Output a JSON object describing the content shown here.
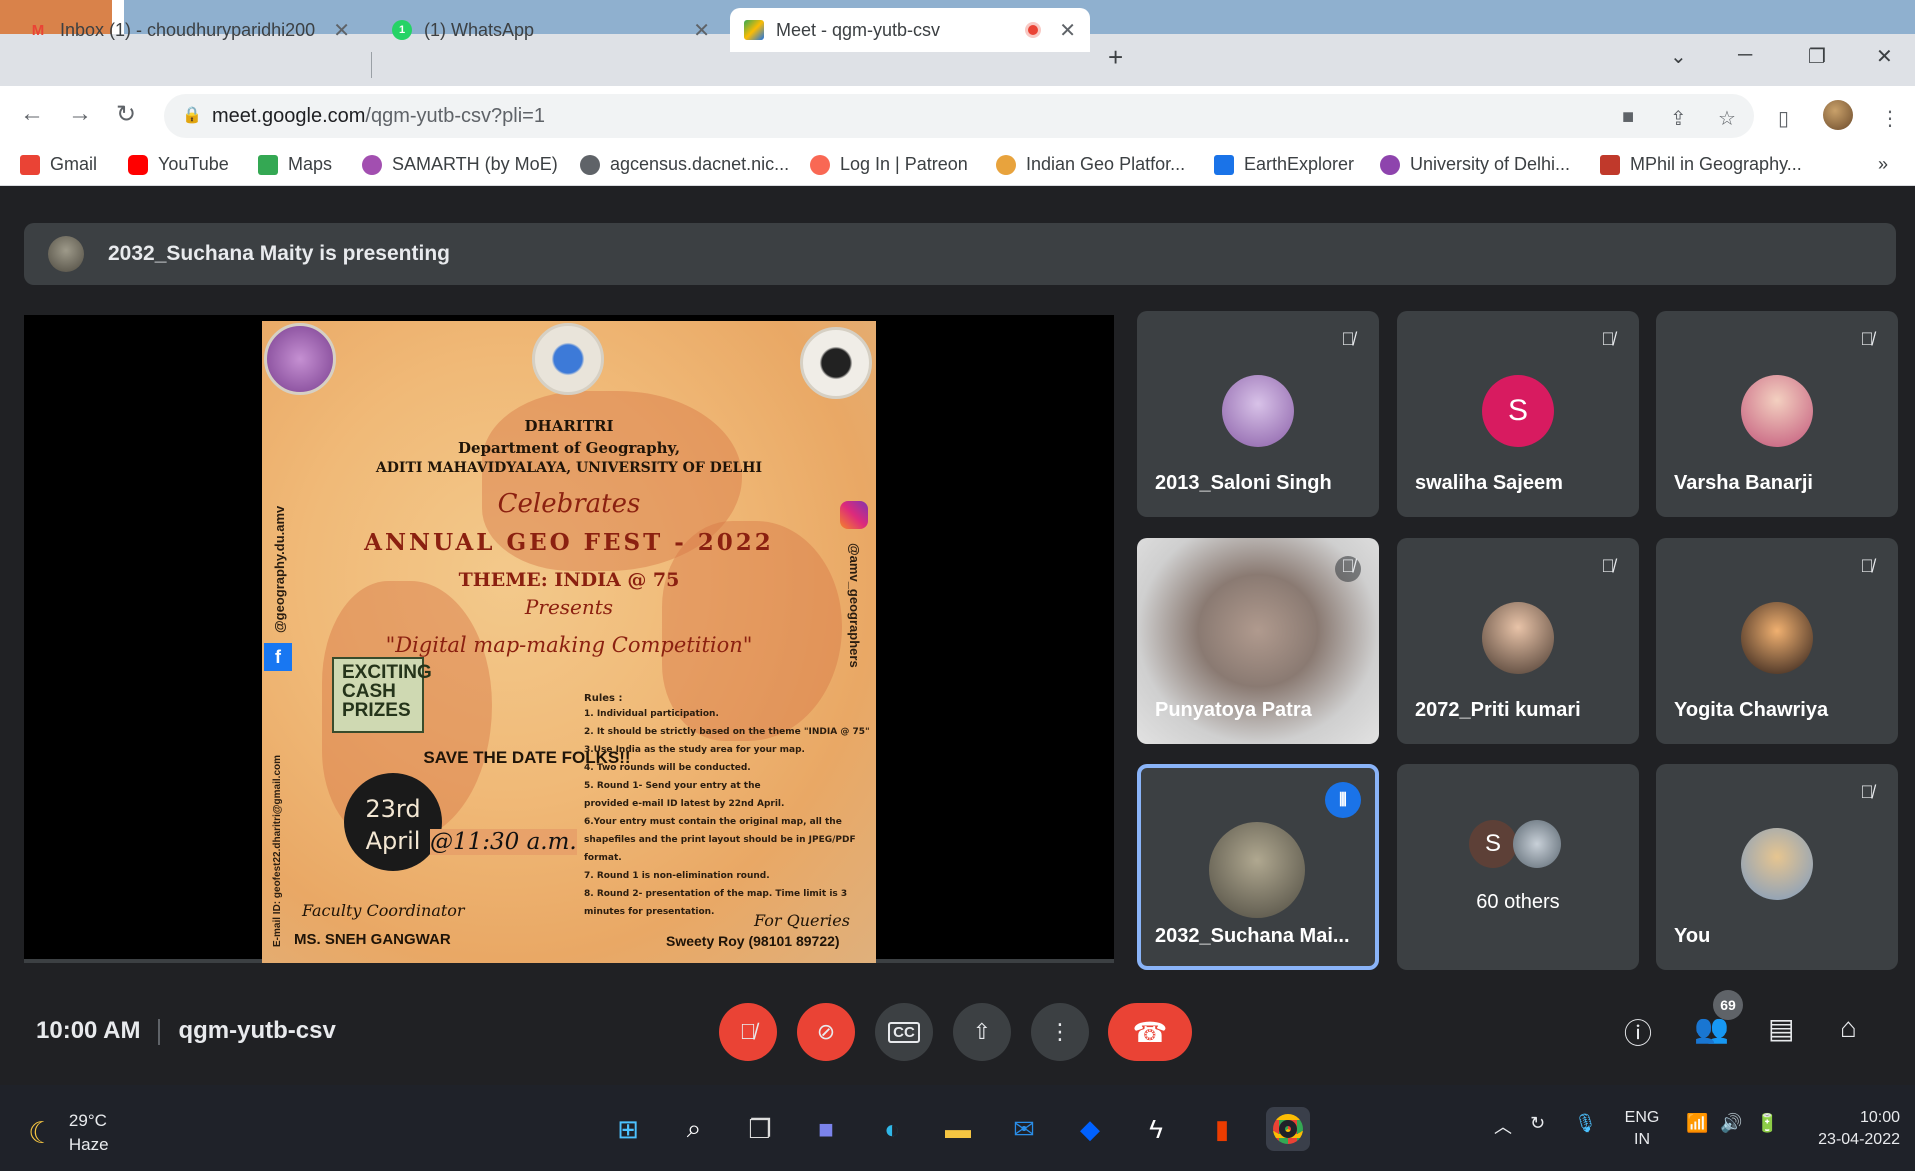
{
  "browser": {
    "tabs": [
      {
        "title": "Inbox (1) - choudhuryparidhi200",
        "icon": "gmail-icon"
      },
      {
        "title": "(1) WhatsApp",
        "icon": "whatsapp-icon"
      },
      {
        "title": "Meet - qgm-yutb-csv",
        "icon": "meet-icon",
        "active": true
      }
    ],
    "new_tab": "+",
    "url_host": "meet.google.com",
    "url_path": "/qgm-yutb-csv?pli=1",
    "bookmarks": [
      {
        "label": "Gmail",
        "color": "#ea4335"
      },
      {
        "label": "YouTube",
        "color": "#ff0000"
      },
      {
        "label": "Maps",
        "color": "#34a853"
      },
      {
        "label": "SAMARTH (by MoE)",
        "color": "#a24fb0"
      },
      {
        "label": "agcensus.dacnet.nic...",
        "color": "#5f6368"
      },
      {
        "label": "Log In | Patreon",
        "color": "#f96854"
      },
      {
        "label": "Indian Geo Platfor...",
        "color": "#e8a33d"
      },
      {
        "label": "EarthExplorer",
        "color": "#1a73e8"
      },
      {
        "label": "University of Delhi...",
        "color": "#8e44ad"
      },
      {
        "label": "MPhil in Geography...",
        "color": "#c0392b"
      }
    ],
    "more_bookmarks": "»"
  },
  "meet": {
    "presenting_banner": "2032_Suchana Maity is presenting",
    "poster": {
      "org": "DHARITRI",
      "dept": "Department of Geography,",
      "college": "ADITI MAHAVIDYALAYA, UNIVERSITY OF DELHI",
      "celebrates": "Celebrates",
      "event": "ANNUAL GEO FEST - 2022",
      "theme": "THEME: INDIA @ 75",
      "presents": "Presents",
      "competition": "\"Digital map-making Competition\"",
      "cash_prizes": "EXCITING CASH PRIZES",
      "save_date": "SAVE THE DATE FOLKS!!",
      "date_day": "23rd",
      "date_month": "April",
      "time": "@11:30 a.m.",
      "coordinator_label": "Faculty Coordinator",
      "coordinator_name": "MS. SNEH GANGWAR",
      "queries_label": "For Queries",
      "queries_contact": "Sweety Roy (98101 89722)",
      "rules_title": "Rules :",
      "rules": [
        "1. Individual participation.",
        "2. It should be strictly based on the theme \"INDIA @ 75\"",
        "3.Use India as the study area for your map.",
        "4. Two rounds will be conducted.",
        "5. Round 1- Send your entry at the",
        "provided e-mail ID latest by 22nd April.",
        "6.Your entry must contain the original map, all the",
        "shapefiles and the print layout should be in JPEG/PDF",
        "format.",
        "7. Round 1 is non-elimination round.",
        "8. Round 2- presentation of the map. Time limit is 3",
        "minutes for presentation."
      ],
      "side_left": "@geography.du.amv",
      "side_right": "@amv_geographers",
      "side_email": "E-mail ID: geofest22.dharitri@gmail.com"
    },
    "participants": [
      {
        "name": "2013_Saloni Singh",
        "muted": true,
        "avatar_color": "#b68fc4"
      },
      {
        "name": "swaliha Sajeem",
        "muted": true,
        "initial": "S",
        "avatar_color": "#d81b60"
      },
      {
        "name": "Varsha Banarji",
        "muted": true,
        "avatar_color": "#e8b8c0"
      },
      {
        "name": "Punyatoya Patra",
        "muted": true,
        "video": true
      },
      {
        "name": "2072_Priti kumari",
        "muted": true,
        "avatar_color": "#c9a58a"
      },
      {
        "name": "Yogita Chawriya",
        "muted": true,
        "avatar_color": "#d9a066"
      },
      {
        "name": "2032_Suchana Mai...",
        "speaking": true,
        "avatar_color": "#6b6455"
      },
      {
        "name": "60 others",
        "initial": "S",
        "avatar_color": "#5d4037"
      },
      {
        "name": "You",
        "muted": true,
        "avatar_color": "#b89a6a"
      }
    ],
    "time": "10:00 AM",
    "meeting_code": "qgm-yutb-csv",
    "people_count": "69",
    "accent": "#1a73e8",
    "danger": "#ea4335"
  },
  "taskbar": {
    "temperature": "29°C",
    "weather": "Haze",
    "lang_top": "ENG",
    "lang_bottom": "IN",
    "clock_time": "10:00",
    "clock_date": "23-04-2022"
  }
}
